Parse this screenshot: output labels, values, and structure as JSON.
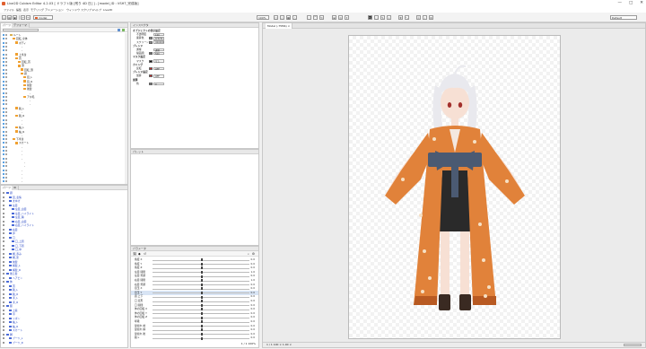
{
  "window": {
    "title": "Live2D Cubism Editor 4.2.03 [ ドラフト版 [残り 4D 日] ] - [model_ID : VSHT_完成版]",
    "controls": [
      "—",
      "□",
      "✕"
    ]
  },
  "menu": [
    "ファイル",
    "編集",
    "表示",
    "モデリング",
    "アニメーション",
    "ウィンドウ",
    "スクリプト",
    "ヘルプ",
    "Live2D"
  ],
  "toolbar": {
    "model_combo": "model",
    "zoom_label": "100%",
    "right_combo": "Default"
  },
  "tree_panel": {
    "tabs": [
      "パーツ",
      "デフォーマ"
    ],
    "rows": [
      {
        "label": "ルート",
        "indent": 0,
        "icon": "folder"
      },
      {
        "label": "回転_全体",
        "indent": 1,
        "icon": "bone"
      },
      {
        "label": "ボディ",
        "indent": 2,
        "icon": "bone"
      },
      {
        "label": "-",
        "indent": 3,
        "icon": "none"
      },
      {
        "label": "-",
        "indent": 3,
        "icon": "none"
      },
      {
        "label": "上半身",
        "indent": 2,
        "icon": "bone"
      },
      {
        "label": "首",
        "indent": 2,
        "icon": "bone"
      },
      {
        "label": "回転_首",
        "indent": 3,
        "icon": "bone"
      },
      {
        "label": "頭",
        "indent": 3,
        "icon": "bone"
      },
      {
        "label": "回転_頭",
        "indent": 4,
        "icon": "bone"
      },
      {
        "label": "顔",
        "indent": 4,
        "icon": "bone"
      },
      {
        "label": "目_L",
        "indent": 5,
        "icon": "bone"
      },
      {
        "label": "目_R",
        "indent": 5,
        "icon": "bone"
      },
      {
        "label": "前髪",
        "indent": 5,
        "icon": "bone"
      },
      {
        "label": "後髪",
        "indent": 5,
        "icon": "bone"
      },
      {
        "label": "-",
        "indent": 6,
        "icon": "none"
      },
      {
        "label": "アホ毛",
        "indent": 5,
        "icon": "bone"
      },
      {
        "label": "-",
        "indent": 6,
        "icon": "none"
      },
      {
        "label": "-",
        "indent": 6,
        "icon": "none"
      },
      {
        "label": "腕_L",
        "indent": 2,
        "icon": "bone"
      },
      {
        "label": "-",
        "indent": 3,
        "icon": "none"
      },
      {
        "label": "腕_R",
        "indent": 2,
        "icon": "bone"
      },
      {
        "label": "-",
        "indent": 3,
        "icon": "none"
      },
      {
        "label": "-",
        "indent": 3,
        "icon": "none"
      },
      {
        "label": "袖_L",
        "indent": 2,
        "icon": "bone"
      },
      {
        "label": "袖_R",
        "indent": 2,
        "icon": "bone"
      },
      {
        "label": "-",
        "indent": 3,
        "icon": "none"
      },
      {
        "label": "下半身",
        "indent": 1,
        "icon": "bone"
      },
      {
        "label": "スカート",
        "indent": 2,
        "icon": "bone"
      },
      {
        "label": "-",
        "indent": 3,
        "icon": "none"
      },
      {
        "label": "-",
        "indent": 3,
        "icon": "none"
      },
      {
        "label": "-",
        "indent": 3,
        "icon": "none"
      },
      {
        "label": "-",
        "indent": 3,
        "icon": "none"
      },
      {
        "label": "-",
        "indent": 4,
        "icon": "none"
      },
      {
        "label": "-",
        "indent": 4,
        "icon": "none"
      },
      {
        "label": "-",
        "indent": 3,
        "icon": "none"
      },
      {
        "label": "-",
        "indent": 3,
        "icon": "none"
      },
      {
        "label": "-",
        "indent": 3,
        "icon": "none"
      },
      {
        "label": "-",
        "indent": 3,
        "icon": "none"
      }
    ]
  },
  "parts_panel": {
    "tabs": [
      "パーツ",
      "ID"
    ],
    "rows": [
      {
        "label": "顔",
        "indent": 0
      },
      {
        "label": "目_表情",
        "indent": 1
      },
      {
        "label": "まゆげ",
        "indent": 1
      },
      {
        "label": "左目",
        "indent": 1
      },
      {
        "label": "左目_白目",
        "indent": 2
      },
      {
        "label": "左目_ハイライト",
        "indent": 2
      },
      {
        "label": "左目_瞳",
        "indent": 2
      },
      {
        "label": "右目_白目",
        "indent": 2
      },
      {
        "label": "右目_ハイライト",
        "indent": 2
      },
      {
        "label": "右目",
        "indent": 1
      },
      {
        "label": "鼻",
        "indent": 1
      },
      {
        "label": "口",
        "indent": 1
      },
      {
        "label": "口_上唇",
        "indent": 2
      },
      {
        "label": "口_下唇",
        "indent": 2
      },
      {
        "label": "口_中",
        "indent": 2
      },
      {
        "label": "頬_赤み",
        "indent": 1
      },
      {
        "label": "頬_影",
        "indent": 1
      },
      {
        "label": "前髪",
        "indent": 1
      },
      {
        "label": "横髪_L",
        "indent": 1
      },
      {
        "label": "横髪_R",
        "indent": 1
      },
      {
        "label": "後ろ髪",
        "indent": 0
      },
      {
        "label": "ヘアピン",
        "indent": 1
      },
      {
        "label": "体",
        "indent": 0
      },
      {
        "label": "首",
        "indent": 1
      },
      {
        "label": "腕_L",
        "indent": 1
      },
      {
        "label": "腕_R",
        "indent": 1
      },
      {
        "label": "手_L",
        "indent": 1
      },
      {
        "label": "手_R",
        "indent": 1
      },
      {
        "label": "服",
        "indent": 0
      },
      {
        "label": "上着",
        "indent": 1
      },
      {
        "label": "帯",
        "indent": 1
      },
      {
        "label": "リボン",
        "indent": 1
      },
      {
        "label": "袖_L",
        "indent": 1
      },
      {
        "label": "袖_R",
        "indent": 1
      },
      {
        "label": "スカート",
        "indent": 1
      },
      {
        "label": "脚",
        "indent": 0
      },
      {
        "label": "ブーツ_L",
        "indent": 1
      },
      {
        "label": "ブーツ_R",
        "indent": 1
      }
    ]
  },
  "inspector": {
    "title": "インスペクタ",
    "rows": [
      {
        "label": "オブジェクトの表示設定",
        "type": "section"
      },
      {
        "label": "不透明度",
        "type": "field",
        "value": "100"
      },
      {
        "label": "乗算色",
        "type": "color",
        "color": "#8a8a8a",
        "value": "FFFFFF"
      },
      {
        "label": "スクリーン色",
        "type": "color",
        "color": "#8a8a8a",
        "value": "000000"
      },
      {
        "label": "ブレンド",
        "type": "section"
      },
      {
        "label": "通常",
        "type": "field",
        "value": "通常"
      },
      {
        "label": "描画順",
        "type": "color",
        "color": "#666666",
        "value": "500"
      },
      {
        "label": "マスク設定",
        "type": "section"
      },
      {
        "label": "マスク",
        "type": "color",
        "color": "#111111",
        "value": "なし"
      },
      {
        "label": "カリング",
        "type": "section"
      },
      {
        "label": "反転",
        "type": "color",
        "color": "#cc2020",
        "value": "OFF"
      },
      {
        "label": "ブレンド設定",
        "type": "section"
      },
      {
        "label": "加算",
        "type": "color",
        "color": "#cc2020",
        "value": "OFF"
      },
      {
        "label": "乗算",
        "type": "section"
      },
      {
        "label": "色",
        "type": "color",
        "color": "#777777",
        "value": "0"
      }
    ]
  },
  "middle_panel": {
    "title": "パレット"
  },
  "params_panel": {
    "title": "パラメータ",
    "rows": [
      {
        "name": "角度 X",
        "value": "0.0",
        "knob": 0.5
      },
      {
        "name": "角度 Y",
        "value": "0.0",
        "knob": 0.5
      },
      {
        "name": "角度 Z",
        "value": "0.0",
        "knob": 0.5
      },
      {
        "name": "左目 開閉",
        "value": "1.0",
        "knob": 0.5
      },
      {
        "name": "左目 笑顔",
        "value": "0.0",
        "knob": 0.5
      },
      {
        "name": "右目 開閉",
        "value": "1.0",
        "knob": 0.5
      },
      {
        "name": "右目 笑顔",
        "value": "0.0",
        "knob": 0.5
      },
      {
        "name": "目玉 X",
        "value": "0.0",
        "knob": 0.5
      },
      {
        "name": "目玉 Y",
        "value": "0.0",
        "knob": 0.5
      },
      {
        "name": "眉 上下",
        "value": "0.0",
        "knob": 0.5
      },
      {
        "name": "口 変形",
        "value": "0.0",
        "knob": 0.5
      },
      {
        "name": "口 開閉",
        "value": "0.0",
        "knob": 0.5
      },
      {
        "name": "体の回転 X",
        "value": "0.0",
        "knob": 0.5
      },
      {
        "name": "体の回転 Y",
        "value": "0.0",
        "knob": 0.5
      },
      {
        "name": "体の回転 Z",
        "value": "0.0",
        "knob": 0.5
      },
      {
        "name": "呼吸",
        "value": "0.0",
        "knob": 0.5
      },
      {
        "name": "髪揺れ 前",
        "value": "0.0",
        "knob": 0.5
      },
      {
        "name": "髪揺れ 横",
        "value": "0.0",
        "knob": 0.5
      },
      {
        "name": "髪揺れ 後",
        "value": "0.0",
        "knob": 0.5
      },
      {
        "name": "腕 L",
        "value": "0.0",
        "knob": 0.5
      }
    ],
    "status": "1 / 1  100%"
  },
  "canvas": {
    "tab_label": "Model (-75Mb) ×",
    "status": "1 / 1   100   ×   1.00   ×",
    "colors": {
      "hair": "#e9e9ee",
      "kimono": "#e1823a",
      "kimono_dark": "#b85a22",
      "obi": "#4b5a72",
      "skin": "#f7e0d4",
      "boots": "#3a2a22",
      "shorts": "#2a2a2a"
    }
  }
}
